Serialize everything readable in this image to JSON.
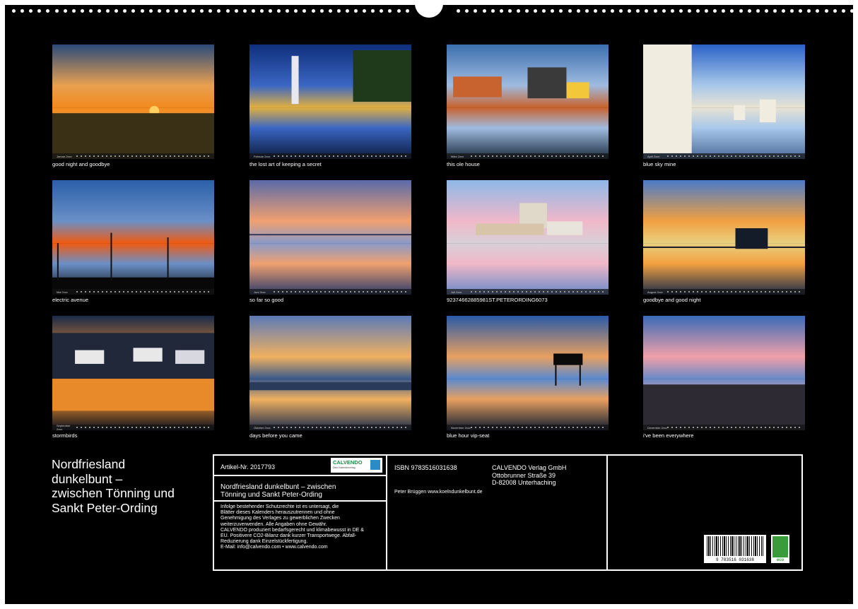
{
  "calendar": {
    "title_lines": [
      "Nordfriesland",
      "dunkelbunt –",
      "zwischen Tönning und",
      "Sankt Peter-Ording"
    ]
  },
  "months": [
    {
      "caption": "good night and goodbye",
      "strip": "Januar 2xxx",
      "palette": [
        "#2a4a7a",
        "#e8a050",
        "#f28a1e",
        "#3a2e18"
      ],
      "scene": "sunset-field"
    },
    {
      "caption": "the lost art of keeping a secret",
      "strip": "Februar 2xxx",
      "palette": [
        "#0f2f7a",
        "#3a66c4",
        "#e0b040",
        "#0b1a3a"
      ],
      "scene": "harbor-crane"
    },
    {
      "caption": "this ole house",
      "strip": "März 2xxx",
      "palette": [
        "#3c6fae",
        "#9fbbe0",
        "#c8622e",
        "#1a2b3c"
      ],
      "scene": "houses"
    },
    {
      "caption": "blue sky mine",
      "strip": "April 2xxx",
      "palette": [
        "#2a62c8",
        "#a8c8ea",
        "#e8e2d2",
        "#4a6a9a"
      ],
      "scene": "beach-chairs"
    },
    {
      "caption": "electric avenue",
      "strip": "Mai 2xxx",
      "palette": [
        "#2a5fa8",
        "#6a90c8",
        "#f05a10",
        "#0a0a0a"
      ],
      "scene": "windmills"
    },
    {
      "caption": "so far so good",
      "strip": "Juni 2xxx",
      "palette": [
        "#5a6aa8",
        "#f0a070",
        "#8a9ac8",
        "#2a3a6a"
      ],
      "scene": "mudflat"
    },
    {
      "caption": "92374662885981ST.PETERORDING6073",
      "strip": "Juli 2xxx",
      "palette": [
        "#8fb8e8",
        "#f0b8c8",
        "#d8d0d8",
        "#6a8ac8"
      ],
      "scene": "pile-house"
    },
    {
      "caption": "goodbye and good night",
      "strip": "August 2xxx",
      "palette": [
        "#4a7ac8",
        "#f2a040",
        "#e8d080",
        "#1a2a4a"
      ],
      "scene": "pier-sunset"
    },
    {
      "caption": "stormbirds",
      "strip": "September 2xxx",
      "palette": [
        "#1a2a4a",
        "#e88a2a",
        "#c85a1a",
        "#0a1020"
      ],
      "scene": "boats"
    },
    {
      "caption": "days before you came",
      "strip": "Oktober 2xxx",
      "palette": [
        "#5a7ab8",
        "#f0b060",
        "#3a5a8a",
        "#1a2a4a"
      ],
      "scene": "cloud-sunset"
    },
    {
      "caption": "blue hour vip-seat",
      "strip": "November 2xxx",
      "palette": [
        "#2a5aa8",
        "#e8a060",
        "#5a8ad0",
        "#0e1a30"
      ],
      "scene": "stilt-house"
    },
    {
      "caption": "i've been everywhere",
      "strip": "Dezember 2xxx",
      "palette": [
        "#3a6ab8",
        "#f0a0a8",
        "#6a8ac8",
        "#2a2a3a"
      ],
      "scene": "pink-clouds"
    }
  ],
  "info": {
    "article": "Artikel-Nr. 2017793",
    "logo_text": "CALVENDO",
    "logo_sub": "Dein Kalenderverlag",
    "short_title_lines": [
      "Nordfriesland dunkelbunt – zwischen",
      "Tönning und Sankt Peter-Ording"
    ],
    "legal_lines": [
      "Infolge bestehender Schutzrechte ist es untersagt, die",
      "Blätter dieses Kalenders herauszutrennen und ohne",
      "Genehmigung des Verlages zu gewerblichen Zwecken",
      "weiterzuverwenden. Alle Angaben ohne Gewähr.",
      "CALVENDO produziert bedarfsgerecht und klimabewusst in DE &",
      "EU. Positivere CO2-Bilanz dank kurzer Transportwege. Abfall-",
      "Reduzierung dank Einzelstückfertigung.",
      "E-Mail: info@calvendo.com • www.calvendo.com"
    ],
    "isbn": "ISBN 9783516031638",
    "publisher_lines": [
      "CALVENDO Verlag GmbH",
      "Ottobrunner Straße 39",
      "D-82008 Unterhaching"
    ],
    "author": "Peter Brüggen www.koelndunkelbunt.de",
    "barcode_number": "9 783516 031638",
    "eco_label": "eco"
  }
}
